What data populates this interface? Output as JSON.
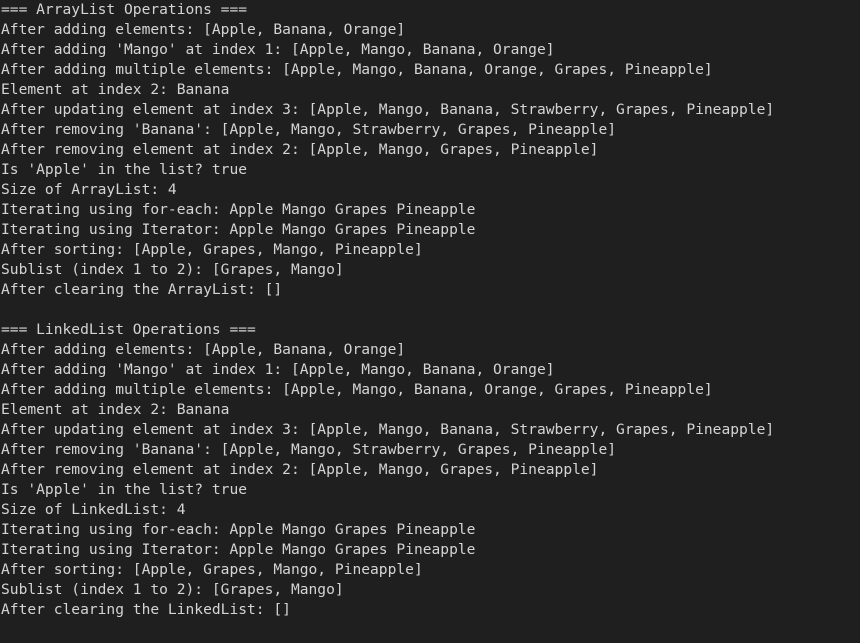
{
  "console": {
    "lines": [
      "=== ArrayList Operations ===",
      "After adding elements: [Apple, Banana, Orange]",
      "After adding 'Mango' at index 1: [Apple, Mango, Banana, Orange]",
      "After adding multiple elements: [Apple, Mango, Banana, Orange, Grapes, Pineapple]",
      "Element at index 2: Banana",
      "After updating element at index 3: [Apple, Mango, Banana, Strawberry, Grapes, Pineapple]",
      "After removing 'Banana': [Apple, Mango, Strawberry, Grapes, Pineapple]",
      "After removing element at index 2: [Apple, Mango, Grapes, Pineapple]",
      "Is 'Apple' in the list? true",
      "Size of ArrayList: 4",
      "Iterating using for-each: Apple Mango Grapes Pineapple",
      "Iterating using Iterator: Apple Mango Grapes Pineapple",
      "After sorting: [Apple, Grapes, Mango, Pineapple]",
      "Sublist (index 1 to 2): [Grapes, Mango]",
      "After clearing the ArrayList: []",
      "",
      "=== LinkedList Operations ===",
      "After adding elements: [Apple, Banana, Orange]",
      "After adding 'Mango' at index 1: [Apple, Mango, Banana, Orange]",
      "After adding multiple elements: [Apple, Mango, Banana, Orange, Grapes, Pineapple]",
      "Element at index 2: Banana",
      "After updating element at index 3: [Apple, Mango, Banana, Strawberry, Grapes, Pineapple]",
      "After removing 'Banana': [Apple, Mango, Strawberry, Grapes, Pineapple]",
      "After removing element at index 2: [Apple, Mango, Grapes, Pineapple]",
      "Is 'Apple' in the list? true",
      "Size of LinkedList: 4",
      "Iterating using for-each: Apple Mango Grapes Pineapple",
      "Iterating using Iterator: Apple Mango Grapes Pineapple",
      "After sorting: [Apple, Grapes, Mango, Pineapple]",
      "Sublist (index 1 to 2): [Grapes, Mango]",
      "After clearing the LinkedList: []"
    ]
  },
  "colors": {
    "background": "#1f1f1f",
    "text": "#d4d4d4"
  }
}
